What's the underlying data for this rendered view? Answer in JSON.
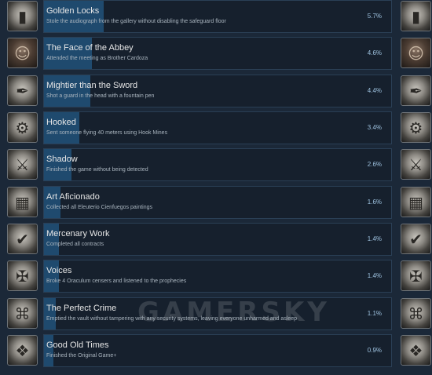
{
  "achievements": [
    {
      "title": "Golden Locks",
      "description": "Stole the audiograph from the gallery without disabling the safeguard floor",
      "percent": "5.7%",
      "fill_fraction": 0.057,
      "icon": "gold-bar-icon",
      "icon_style": "metal"
    },
    {
      "title": "The Face of the Abbey",
      "description": "Attended the meeting as Brother Cardoza",
      "percent": "4.6%",
      "fill_fraction": 0.046,
      "icon": "monk-portrait-icon",
      "icon_style": "portrait"
    },
    {
      "title": "Mightier than the Sword",
      "description": "Shot a guard in the head with a fountain pen",
      "percent": "4.4%",
      "fill_fraction": 0.044,
      "icon": "fountain-pen-icon",
      "icon_style": "metal"
    },
    {
      "title": "Hooked",
      "description": "Sent someone flying 40 meters using Hook Mines",
      "percent": "3.4%",
      "fill_fraction": 0.034,
      "icon": "hook-mine-icon",
      "icon_style": "metal"
    },
    {
      "title": "Shadow",
      "description": "Finished the game without being detected",
      "percent": "2.6%",
      "fill_fraction": 0.026,
      "icon": "shadow-figure-icon",
      "icon_style": "metal"
    },
    {
      "title": "Art Aficionado",
      "description": "Collected all Eleuterio Cienfuegos paintings",
      "percent": "1.6%",
      "fill_fraction": 0.016,
      "icon": "paintings-icon",
      "icon_style": "metal"
    },
    {
      "title": "Mercenary Work",
      "description": "Completed all contracts",
      "percent": "1.4%",
      "fill_fraction": 0.014,
      "icon": "contract-check-icon",
      "icon_style": "metal"
    },
    {
      "title": "Voices",
      "description": "Broke 4 Oraculum censers and listened to the prophecies",
      "percent": "1.4%",
      "fill_fraction": 0.014,
      "icon": "censer-icon",
      "icon_style": "metal"
    },
    {
      "title": "The Perfect Crime",
      "description": "Emptied the vault without tampering with any security systems, leaving everyone unharmed and asleep",
      "percent": "1.1%",
      "fill_fraction": 0.011,
      "icon": "vault-icon",
      "icon_style": "metal"
    },
    {
      "title": "Good Old Times",
      "description": "Finished the Original Game+",
      "percent": "0.9%",
      "fill_fraction": 0.009,
      "icon": "emblem-icon",
      "icon_style": "metal"
    }
  ],
  "watermark": "GAMERSKY",
  "colors": {
    "background": "#1b2838",
    "panel": "#16202d",
    "fill": "#1f4a6e",
    "percent_text": "#9fc3e0"
  }
}
